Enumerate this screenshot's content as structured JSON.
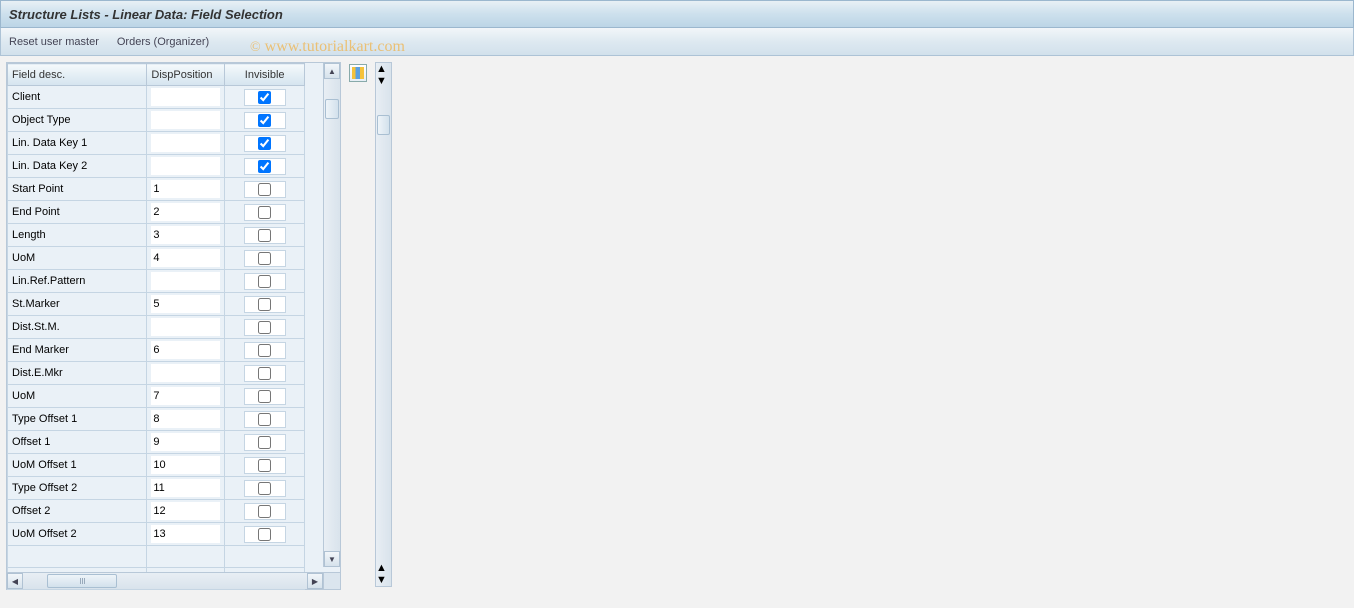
{
  "title": "Structure Lists - Linear Data: Field Selection",
  "toolbar": {
    "reset_label": "Reset user master",
    "orders_label": "Orders (Organizer)"
  },
  "watermark": "© www.tutorialkart.com",
  "table": {
    "headers": {
      "desc": "Field desc.",
      "pos": "DispPosition",
      "inv": "Invisible"
    },
    "rows": [
      {
        "desc": "Client",
        "pos": "",
        "inv": true
      },
      {
        "desc": "Object Type",
        "pos": "",
        "inv": true
      },
      {
        "desc": "Lin. Data Key 1",
        "pos": "",
        "inv": true
      },
      {
        "desc": "Lin. Data Key 2",
        "pos": "",
        "inv": true
      },
      {
        "desc": "Start Point",
        "pos": "1",
        "inv": false
      },
      {
        "desc": "End Point",
        "pos": "2",
        "inv": false
      },
      {
        "desc": "Length",
        "pos": "3",
        "inv": false
      },
      {
        "desc": "UoM",
        "pos": "4",
        "inv": false
      },
      {
        "desc": "Lin.Ref.Pattern",
        "pos": "",
        "inv": false
      },
      {
        "desc": "St.Marker",
        "pos": "5",
        "inv": false
      },
      {
        "desc": "Dist.St.M.",
        "pos": "",
        "inv": false
      },
      {
        "desc": "End Marker",
        "pos": "6",
        "inv": false
      },
      {
        "desc": "Dist.E.Mkr",
        "pos": "",
        "inv": false
      },
      {
        "desc": "UoM",
        "pos": "7",
        "inv": false
      },
      {
        "desc": "Type Offset 1",
        "pos": "8",
        "inv": false
      },
      {
        "desc": "Offset 1",
        "pos": "9",
        "inv": false
      },
      {
        "desc": "UoM Offset 1",
        "pos": "10",
        "inv": false
      },
      {
        "desc": "Type Offset 2",
        "pos": "11",
        "inv": false
      },
      {
        "desc": "Offset 2",
        "pos": "12",
        "inv": false
      },
      {
        "desc": "UoM Offset 2",
        "pos": "13",
        "inv": false
      }
    ]
  }
}
